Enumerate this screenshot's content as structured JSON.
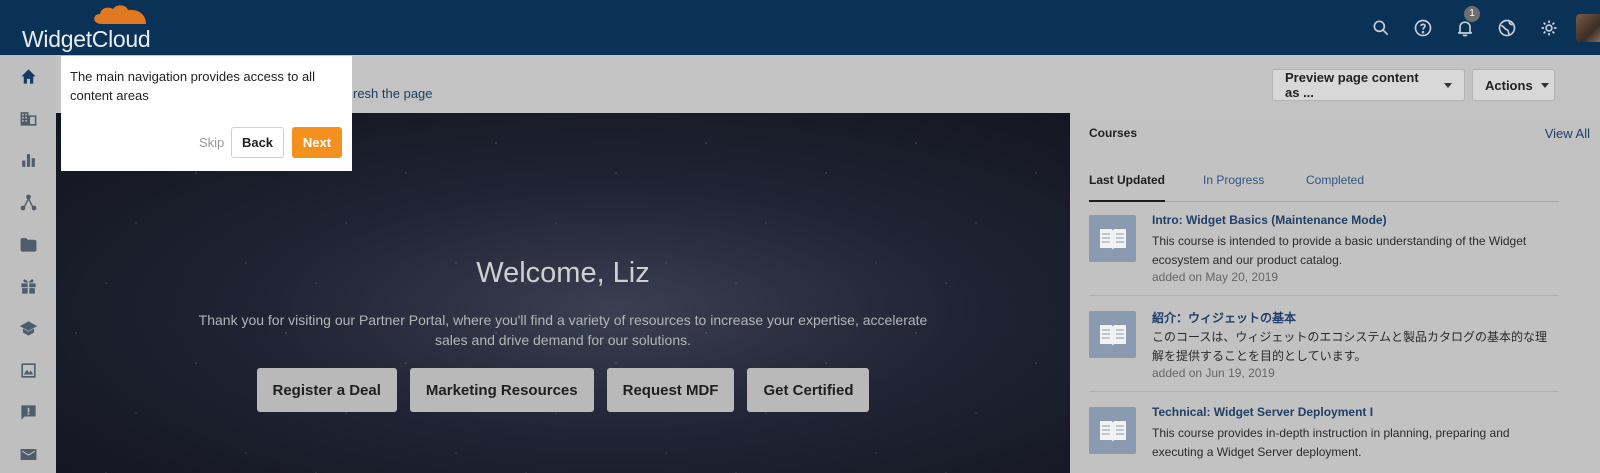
{
  "app": {
    "logo_text": "WidgetCloud"
  },
  "header": {
    "icons": [
      "search-icon",
      "help-icon",
      "bell-icon",
      "globe-icon",
      "gear-icon"
    ],
    "notification_count": "1"
  },
  "subheader": {
    "refresh_text": "resh the page",
    "preview_label": "Preview page content as ...",
    "actions_label": "Actions"
  },
  "leftnav": {
    "items": [
      "home-icon",
      "building-icon",
      "chart-icon",
      "network-icon",
      "folder-icon",
      "gift-icon",
      "school-icon",
      "image-icon",
      "feedback-icon",
      "mail-icon"
    ]
  },
  "tooltip": {
    "text": "The main navigation provides access to all content areas",
    "skip": "Skip",
    "back": "Back",
    "next": "Next"
  },
  "hero": {
    "title": "Welcome, Liz",
    "text": "Thank you for visiting our Partner Portal, where you'll find a variety of resources to increase your expertise, accelerate sales and drive demand for our solutions.",
    "buttons": [
      "Register a Deal",
      "Marketing Resources",
      "Request MDF",
      "Get Certified"
    ]
  },
  "courses": {
    "title": "Courses",
    "view_all": "View All",
    "tabs": [
      "Last Updated",
      "In Progress",
      "Completed"
    ],
    "items": [
      {
        "title": "Intro: Widget Basics (Maintenance Mode)",
        "desc": "This course is intended to provide a basic understanding of the Widget ecosystem and our product catalog.",
        "date": "added on May 20, 2019"
      },
      {
        "title": "紹介：ウィジェットの基本",
        "desc": "このコースは、ウィジェットのエコシステムと製品カタログの基本的な理解を提供することを目的としています。",
        "date": "added on Jun 19, 2019"
      },
      {
        "title": "Technical: Widget Server Deployment I",
        "desc": "This course provides in-depth instruction in planning, preparing and executing a Widget Server deployment.",
        "date": ""
      }
    ]
  },
  "colors": {
    "topbar": "#0a3256",
    "accent": "#f4901e",
    "link": "#1c3f66"
  }
}
